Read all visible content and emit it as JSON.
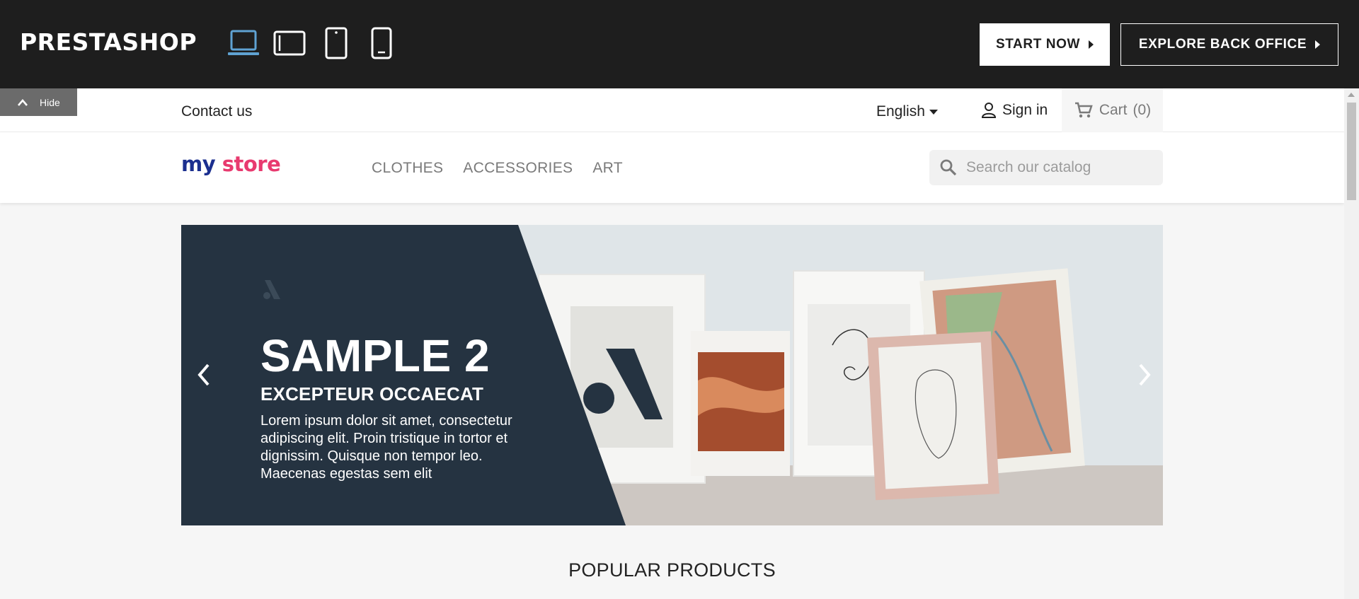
{
  "demo_bar": {
    "brand": "PRESTASHOP",
    "devices": [
      "laptop-icon",
      "tablet-landscape-icon",
      "tablet-portrait-icon",
      "mobile-icon"
    ],
    "active_device_color": "#5fa2d2",
    "start_now": "START NOW",
    "explore_back_office": "EXPLORE BACK OFFICE"
  },
  "hide_tab": {
    "label": "Hide"
  },
  "nav_top": {
    "contact": "Contact us",
    "language": "English",
    "sign_in": "Sign in",
    "cart": "Cart",
    "cart_count": "(0)"
  },
  "header": {
    "logo_my": "my",
    "logo_store": "store",
    "menu": [
      "CLOTHES",
      "ACCESSORIES",
      "ART"
    ],
    "search_placeholder": "Search our catalog"
  },
  "slider": {
    "title": "SAMPLE 2",
    "subtitle": "EXCEPTEUR OCCAECAT",
    "text": "Lorem ipsum dolor sit amet, consectetur adipiscing elit. Proin tristique in tortor et dignissim. Quisque non tempor leo. Maecenas egestas sem elit",
    "panel_color": "#253341"
  },
  "section_title": "POPULAR PRODUCTS"
}
